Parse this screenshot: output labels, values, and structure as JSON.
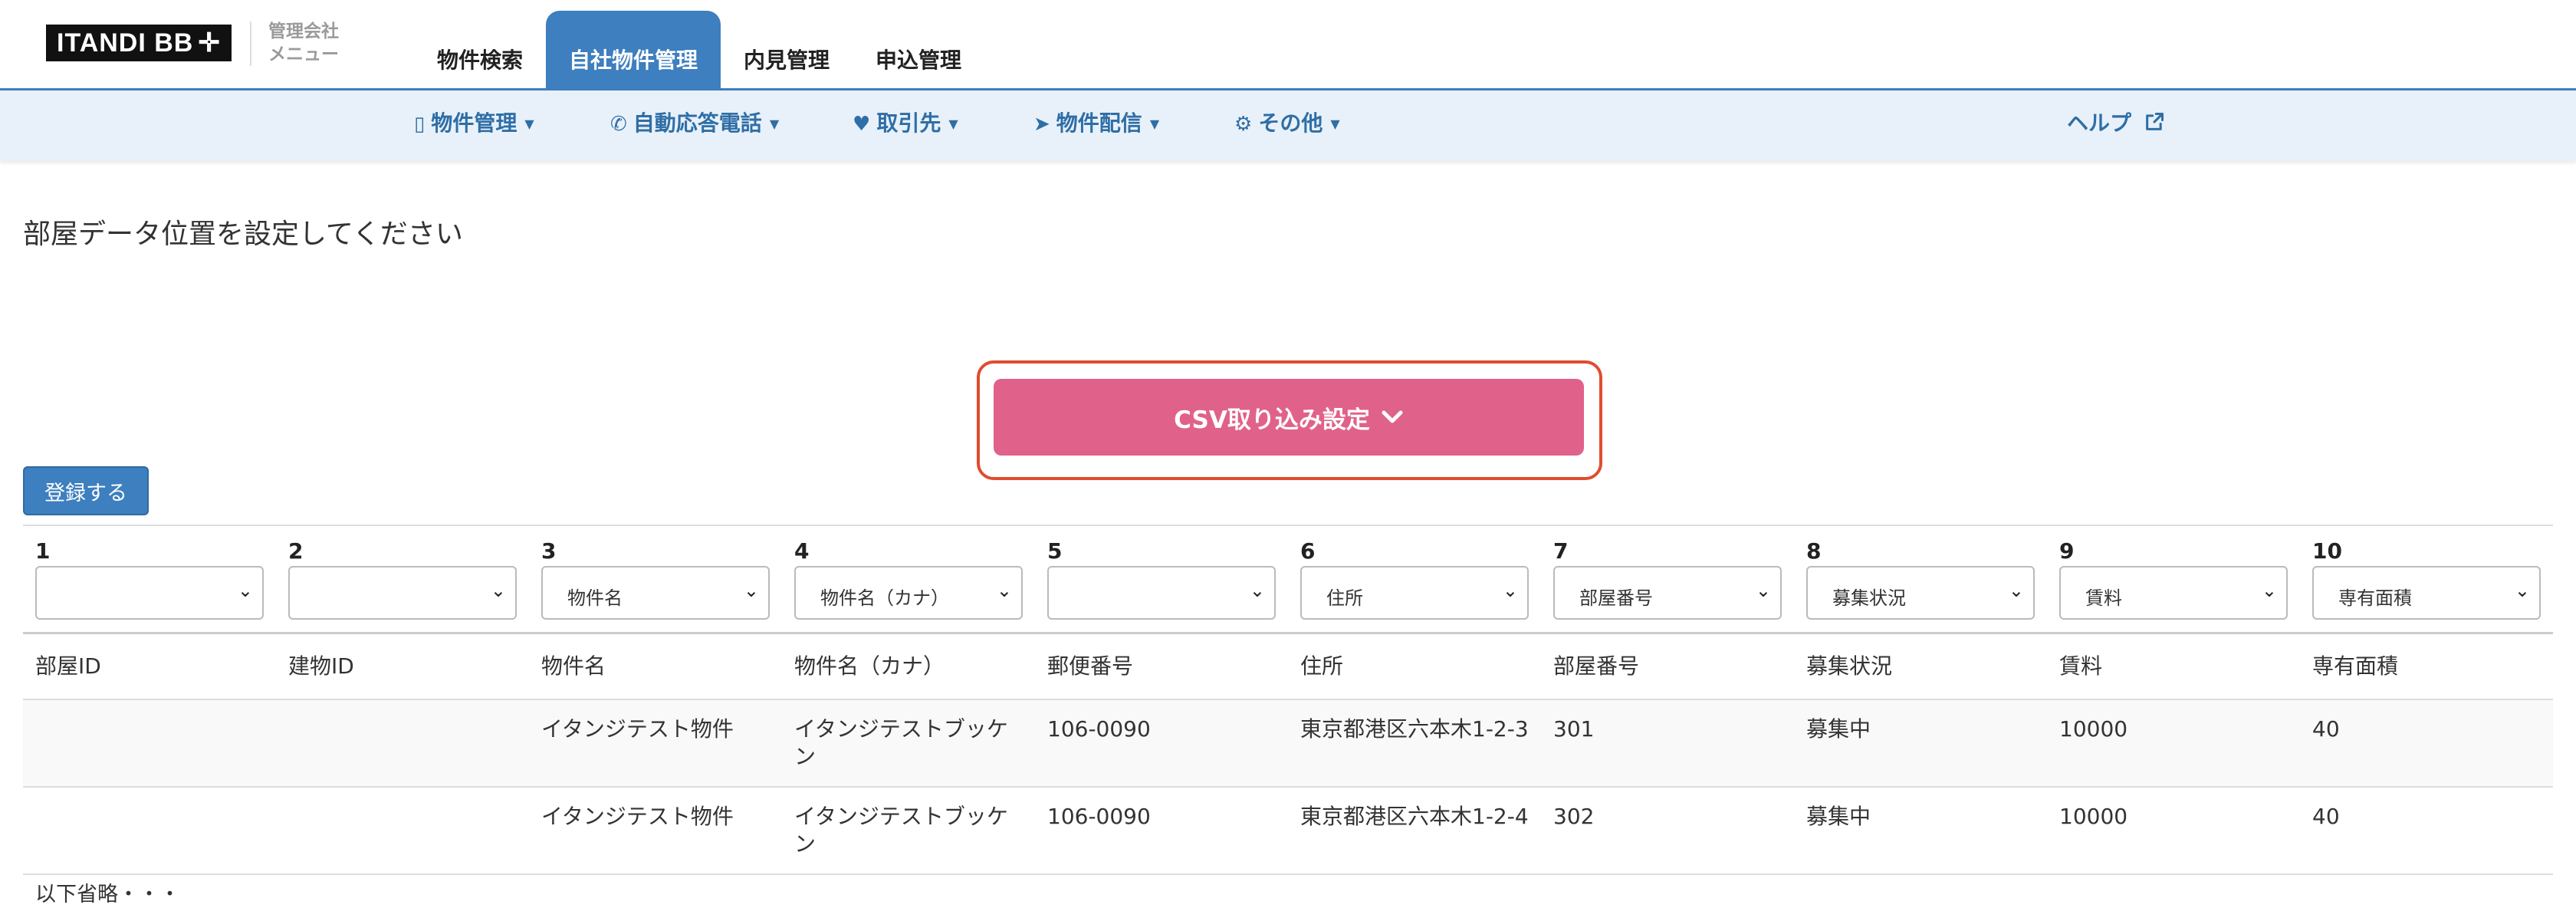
{
  "header": {
    "logo": "ITANDI BB",
    "logo_mark": "✛",
    "logo_sub_line1": "管理会社",
    "logo_sub_line2": "メニュー",
    "tabs": [
      {
        "label": "物件検索",
        "active": false
      },
      {
        "label": "自社物件管理",
        "active": true
      },
      {
        "label": "内見管理",
        "active": false
      },
      {
        "label": "申込管理",
        "active": false
      }
    ]
  },
  "subnav": {
    "items": [
      {
        "icon": "building-icon",
        "glyph": "▯",
        "label": "物件管理"
      },
      {
        "icon": "phone-icon",
        "glyph": "✆",
        "label": "自動応答電話"
      },
      {
        "icon": "heartbeat-icon",
        "glyph": "♥",
        "label": "取引先"
      },
      {
        "icon": "paper-plane-icon",
        "glyph": "➤",
        "label": "物件配信"
      },
      {
        "icon": "gear-icon",
        "glyph": "⚙",
        "label": "その他"
      }
    ],
    "help_label": "ヘルプ",
    "help_icon": "external-link-icon",
    "caret": "▼"
  },
  "main": {
    "page_title": "部屋データ位置を設定してください",
    "csv_button_label": "CSV取り込み設定",
    "csv_button_chevron": "❯",
    "register_button_label": "登録する",
    "highlight_color": "#e04c2f",
    "accent_color": "#3d7fbf",
    "csv_button_color": "#e0628a"
  },
  "table": {
    "columns": [
      {
        "num": "1",
        "select": "",
        "header": "部屋ID"
      },
      {
        "num": "2",
        "select": "",
        "header": "建物ID"
      },
      {
        "num": "3",
        "select": "物件名",
        "header": "物件名"
      },
      {
        "num": "4",
        "select": "物件名（カナ）",
        "header": "物件名（カナ）"
      },
      {
        "num": "5",
        "select": "",
        "header": "郵便番号"
      },
      {
        "num": "6",
        "select": "住所",
        "header": "住所"
      },
      {
        "num": "7",
        "select": "部屋番号",
        "header": "部屋番号"
      },
      {
        "num": "8",
        "select": "募集状況",
        "header": "募集状況"
      },
      {
        "num": "9",
        "select": "賃料",
        "header": "賃料"
      },
      {
        "num": "10",
        "select": "専有面積",
        "header": "専有面積"
      }
    ],
    "rows": [
      [
        "",
        "",
        "イタンジテスト物件",
        "イタンジテストブッケン",
        "106-0090",
        "東京都港区六本木1-2-3",
        "301",
        "募集中",
        "10000",
        "40"
      ],
      [
        "",
        "",
        "イタンジテスト物件",
        "イタンジテストブッケン",
        "106-0090",
        "東京都港区六本木1-2-4",
        "302",
        "募集中",
        "10000",
        "40"
      ]
    ],
    "omitted_note": "以下省略・・・"
  }
}
